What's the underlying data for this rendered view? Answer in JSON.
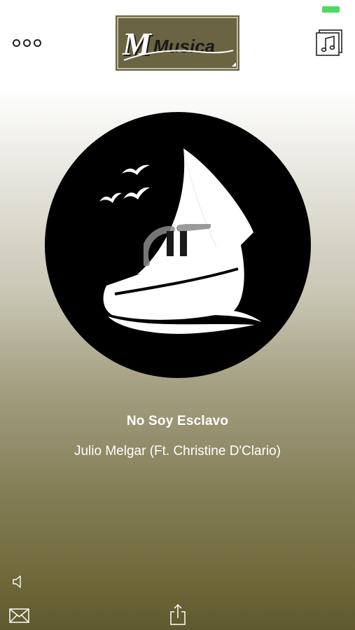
{
  "status_bar": {
    "battery_color": "#4cd964"
  },
  "header": {
    "logo_text": "Musica",
    "more_icon": "more-options-icon",
    "library_icon": "music-library-icon"
  },
  "player": {
    "artwork_icon": "sailboat-artwork",
    "state_icon": "pause-icon",
    "song_title": "No Soy Esclavo",
    "artist": "Julio Melgar (Ft. Christine D'Clario)"
  },
  "footer": {
    "volume_icon": "speaker-icon",
    "mail_icon": "mail-icon",
    "share_icon": "share-icon"
  },
  "colors": {
    "background_top": "#ffffff",
    "background_bottom": "#5f5a2e",
    "logo_frame": "#6b6442",
    "text": "#ffffff"
  }
}
